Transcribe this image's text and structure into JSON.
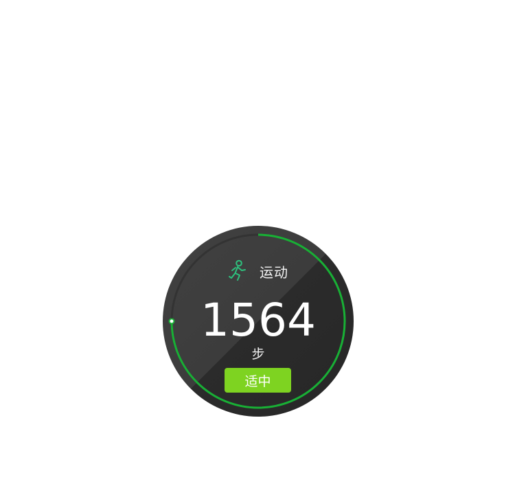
{
  "activity": {
    "label": "运动",
    "icon": "running-person-icon",
    "steps": "1564",
    "unit": "步",
    "status_label": "适中",
    "progress_fraction": 0.75
  },
  "colors": {
    "ring": "#18b035",
    "status_bg": "#7ed321",
    "icon": "#2ec27e",
    "face_light": "#414141",
    "face_dark": "#272727"
  }
}
